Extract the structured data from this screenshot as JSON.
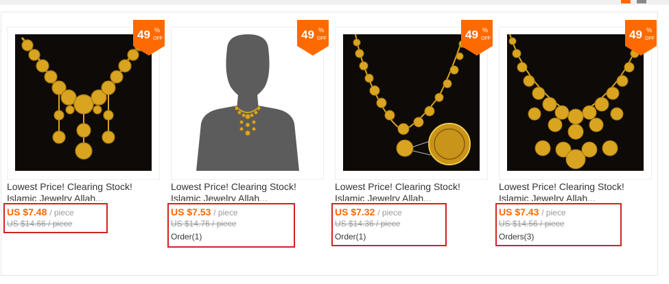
{
  "products": [
    {
      "badge_pct": "49",
      "badge_sym": "%",
      "badge_off": "OFF",
      "title_line1": "Lowest Price! Clearing Stock!",
      "title_line2": "Islamic Jewelry Allah...",
      "price": "US $7.48",
      "unit": "/ piece",
      "orig": "US $14.66 / piece",
      "orders": ""
    },
    {
      "badge_pct": "49",
      "badge_sym": "%",
      "badge_off": "OFF",
      "title_line1": "Lowest Price! Clearing Stock!",
      "title_line2": "Islamic Jewelry Allah...",
      "price": "US $7.53",
      "unit": "/ piece",
      "orig": "US $14.76 / piece",
      "orders": "Order(1)"
    },
    {
      "badge_pct": "49",
      "badge_sym": "%",
      "badge_off": "OFF",
      "title_line1": "Lowest Price! Clearing Stock!",
      "title_line2": "Islamic Jewelry Allah...",
      "price": "US $7.32",
      "unit": "/ piece",
      "orig": "US $14.36 / piece",
      "orders": "Order(1)"
    },
    {
      "badge_pct": "49",
      "badge_sym": "%",
      "badge_off": "OFF",
      "title_line1": "Lowest Price! Clearing Stock!",
      "title_line2": "Islamic Jewelry Allah...",
      "price": "US $7.43",
      "unit": "/ piece",
      "orig": "US $14.56 / piece",
      "orders": "Orders(3)"
    }
  ],
  "colors": {
    "accent": "#ff6a00",
    "price": "#ff6600",
    "highlight_border": "#d42020",
    "gold": "#d9a520",
    "image_bg": "#0d0a08"
  }
}
